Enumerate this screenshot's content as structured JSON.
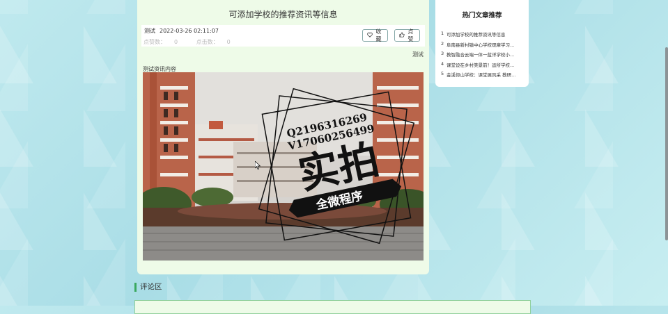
{
  "article": {
    "title": "可添加学校的推荐资讯等信息",
    "author": "测试",
    "datetime": "2022-03-26 02:11:07",
    "likes_label": "点赞数：",
    "likes_value": "0",
    "clicks_label": "点击数：",
    "clicks_value": "0",
    "favorite_label": "收藏",
    "like_label": "点赞",
    "tag": "测试",
    "content": "测试资讯内容",
    "image": {
      "watermark_line1": "Q2196316269",
      "watermark_line2": "V17060256499",
      "watermark_main": "实拍",
      "watermark_banner": "全微程序"
    }
  },
  "sidebar": {
    "title": "热门文章推荐",
    "items": [
      {
        "num": "1",
        "text": "可添加学校的推荐资讯等信息"
      },
      {
        "num": "2",
        "text": "阜南县新村镇中心学校观摩学习..."
      },
      {
        "num": "3",
        "text": "教智融合云端一体一蓝洋学校小..."
      },
      {
        "num": "4",
        "text": "课堂设在乡村美景前！运所学校..."
      },
      {
        "num": "5",
        "text": "金溪仰山学校：课堂展风采 教研..."
      }
    ]
  },
  "comments": {
    "heading": "评论区"
  },
  "colors": {
    "card_bg": "#eefbe8",
    "accent_green": "#3aa85f",
    "page_bg": "#bfe9ee"
  }
}
